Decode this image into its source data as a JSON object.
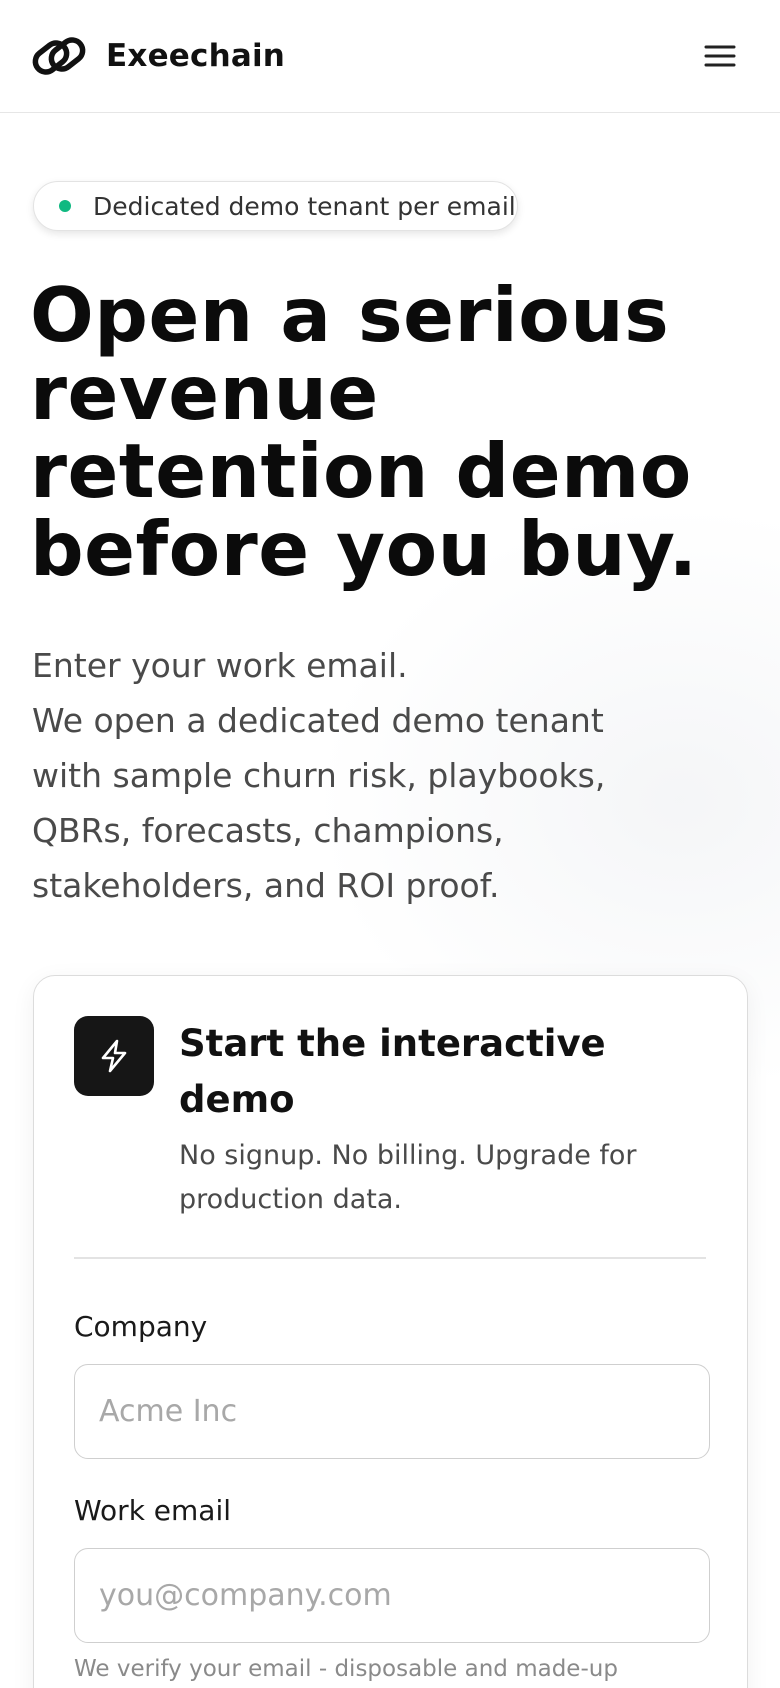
{
  "header": {
    "brand_name": "Exeechain",
    "logo_icon": "chain-link-icon",
    "menu_icon": "hamburger-menu-icon"
  },
  "badge": {
    "text": "Dedicated demo tenant per email",
    "dot_color": "#10b981"
  },
  "hero": {
    "title_lines": [
      "Open a serious",
      "revenue",
      "retention demo",
      "before you buy."
    ],
    "description_lines": [
      "Enter your work email.",
      "We open a dedicated demo tenant",
      "with sample churn risk, playbooks,",
      "QBRs, forecasts, champions,",
      "stakeholders, and ROI proof."
    ]
  },
  "card": {
    "icon": "lightning-bolt-icon",
    "title_lines": [
      "Start the interactive",
      "demo"
    ],
    "subtitle_lines": [
      "No signup. No billing. Upgrade for",
      "production data."
    ],
    "company": {
      "label": "Company",
      "placeholder": "Acme Inc",
      "value": ""
    },
    "email": {
      "label": "Work email",
      "placeholder": "you@company.com",
      "value": ""
    },
    "email_hint": "We verify your email - disposable and made-up"
  },
  "colors": {
    "accent_dark": "#161616",
    "status_green": "#10b981"
  }
}
